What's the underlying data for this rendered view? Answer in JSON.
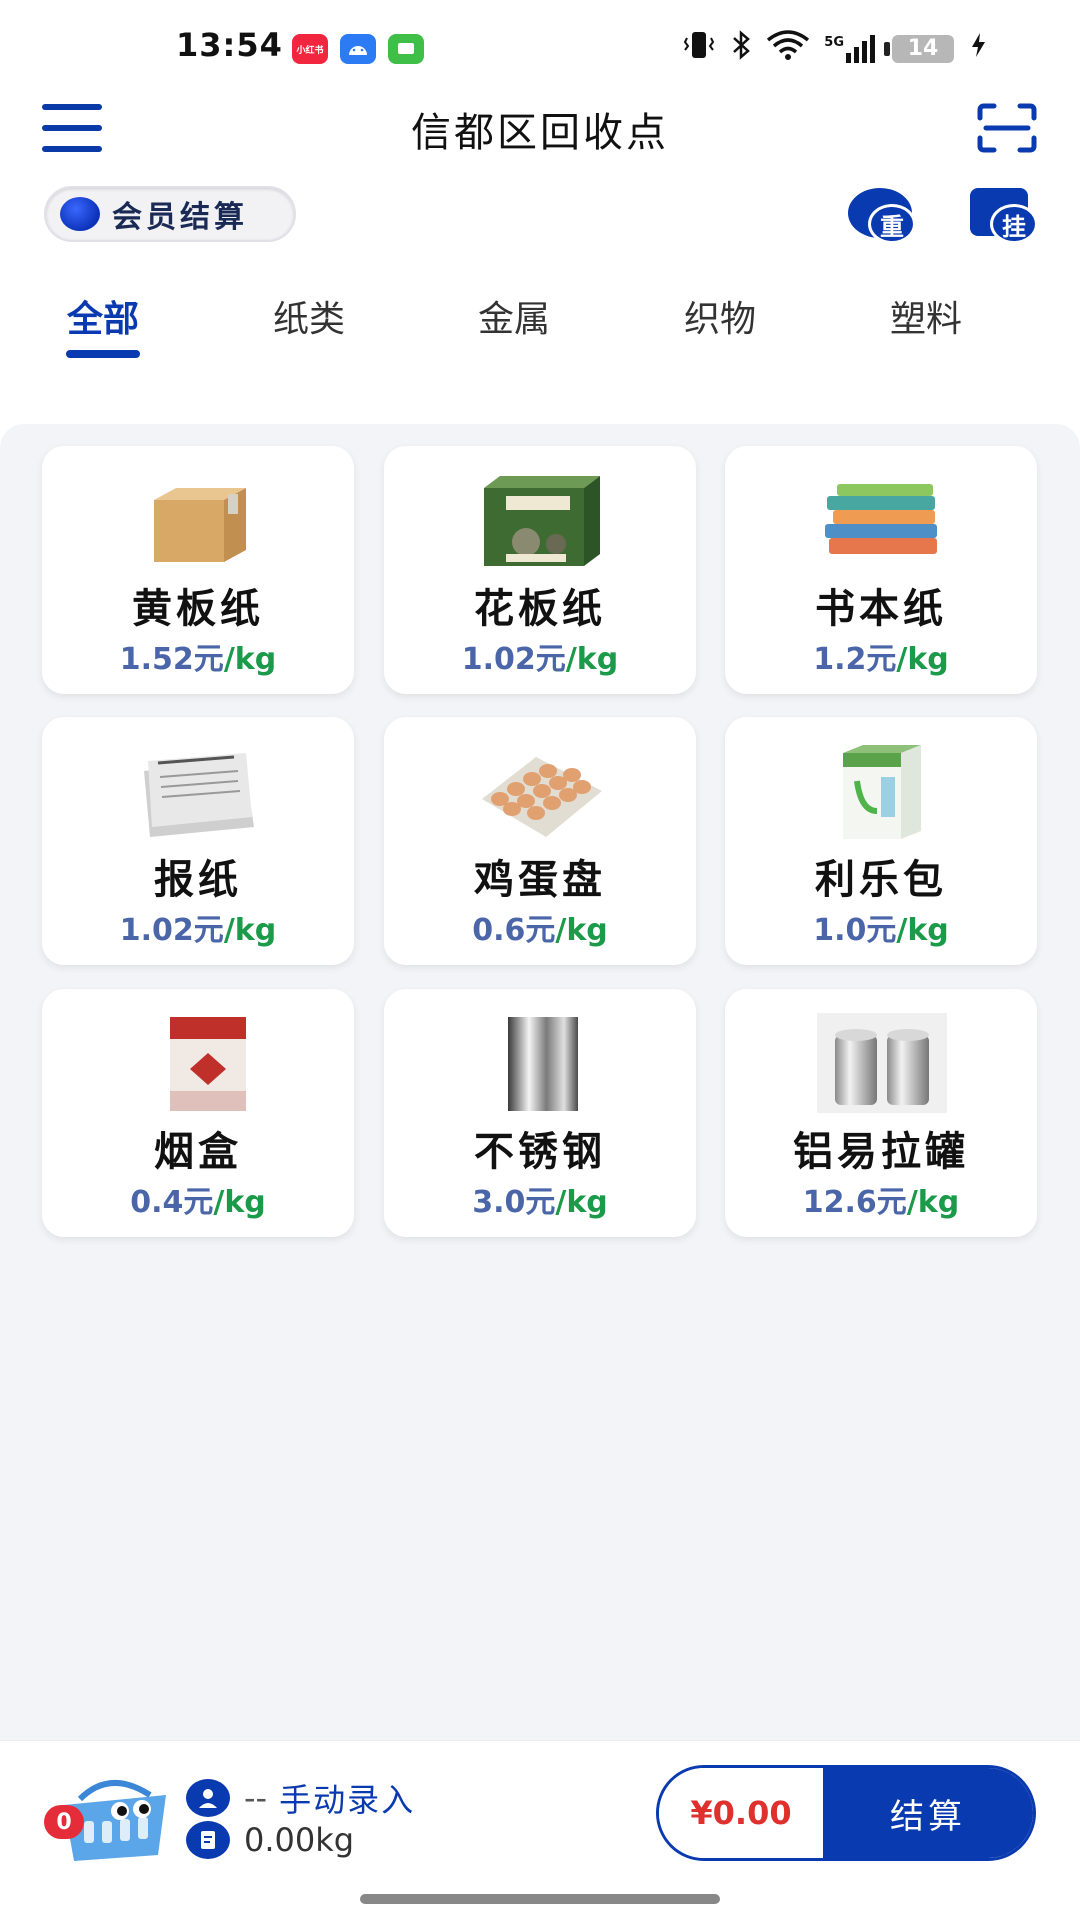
{
  "status_bar": {
    "time": "13:54",
    "app_icons": [
      "小红书",
      "android-icon",
      "message-icon"
    ],
    "network": "5G",
    "battery": "14"
  },
  "header": {
    "title": "信都区回收点",
    "menu_icon": "menu-icon",
    "scan_icon": "scan-icon"
  },
  "member": {
    "label": "会员结算",
    "reweigh_label": "重",
    "hold_label": "挂"
  },
  "tabs": [
    {
      "label": "全部",
      "active": true
    },
    {
      "label": "纸类",
      "active": false
    },
    {
      "label": "金属",
      "active": false
    },
    {
      "label": "织物",
      "active": false
    },
    {
      "label": "塑料",
      "active": false
    }
  ],
  "products": [
    {
      "name": "黄板纸",
      "price": "1.52元",
      "unit": "/kg",
      "icon": "cardboard-box-icon"
    },
    {
      "name": "花板纸",
      "price": "1.02元",
      "unit": "/kg",
      "icon": "printed-box-icon"
    },
    {
      "name": "书本纸",
      "price": "1.2元",
      "unit": "/kg",
      "icon": "books-icon"
    },
    {
      "name": "报纸",
      "price": "1.02元",
      "unit": "/kg",
      "icon": "newspaper-icon"
    },
    {
      "name": "鸡蛋盘",
      "price": "0.6元",
      "unit": "/kg",
      "icon": "egg-tray-icon"
    },
    {
      "name": "利乐包",
      "price": "1.0元",
      "unit": "/kg",
      "icon": "milk-carton-icon"
    },
    {
      "name": "烟盒",
      "price": "0.4元",
      "unit": "/kg",
      "icon": "cigarette-box-icon"
    },
    {
      "name": "不锈钢",
      "price": "3.0元",
      "unit": "/kg",
      "icon": "steel-bar-icon"
    },
    {
      "name": "铝易拉罐",
      "price": "12.6元",
      "unit": "/kg",
      "icon": "cans-icon"
    }
  ],
  "cart": {
    "count": "0",
    "customer_dash": "--",
    "manual_entry": "手动录入",
    "weight": "0.00kg",
    "total": "¥0.00",
    "checkout_label": "结算"
  },
  "colors": {
    "primary": "#0a3ab0",
    "price_number": "#4a66a8",
    "price_unit": "#1b9a4a",
    "total_red": "#e0302e",
    "badge_red": "#e52d3a"
  }
}
